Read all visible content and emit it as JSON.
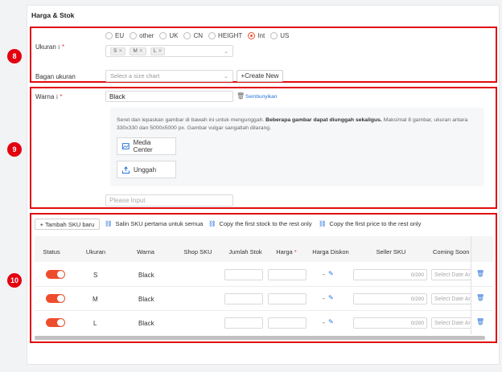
{
  "section": {
    "title": "Harga & Stok"
  },
  "badges": [
    "8",
    "9",
    "10"
  ],
  "size": {
    "label": "Ukuran",
    "options": [
      "EU",
      "other",
      "UK",
      "CN",
      "HEIGHT",
      "Int",
      "US"
    ],
    "selected": "Int",
    "tags": [
      "S",
      "M",
      "L"
    ],
    "chart_label": "Bagan ukuran",
    "chart_placeholder": "Select a size chart",
    "create_button": "Create New"
  },
  "color": {
    "label": "Warna",
    "value": "Black",
    "hide_link": "Sembunyikan",
    "upload_hint_1": "Seret dan lepaskan gambar di bawah ini untuk mengunggah. ",
    "upload_hint_bold": "Beberapa gambar dapat diunggah sekaligus.",
    "upload_hint_2": " Maksimal 8 gambar, ukuran antara 330x330 dan 5000x5000 px. Gambar vulgar sangatlah dilarang.",
    "media_center": "Media Center",
    "upload": "Unggah",
    "new_placeholder": "Please Input"
  },
  "sku": {
    "add_button": "Tambah SKU baru",
    "copy_sku": "Salin SKU pertama untuk semua",
    "copy_stock": "Copy the first stock to the rest only",
    "copy_price": "Copy the first price to the rest only",
    "headers": [
      "Status",
      "Ukuran",
      "Warna",
      "Shop SKU",
      "Jumlah Stok",
      "Harga",
      "Harga Diskon",
      "Seller SKU",
      "Coming Soon"
    ],
    "rows": [
      {
        "size": "S",
        "color": "Black",
        "discount": "-",
        "seller_count": "0/200",
        "date_placeholder": "Select Date And Time"
      },
      {
        "size": "M",
        "color": "Black",
        "discount": "-",
        "seller_count": "0/200",
        "date_placeholder": "Select Date And Time"
      },
      {
        "size": "L",
        "color": "Black",
        "discount": "-",
        "seller_count": "0/200",
        "date_placeholder": "Select Date And Time"
      }
    ]
  }
}
